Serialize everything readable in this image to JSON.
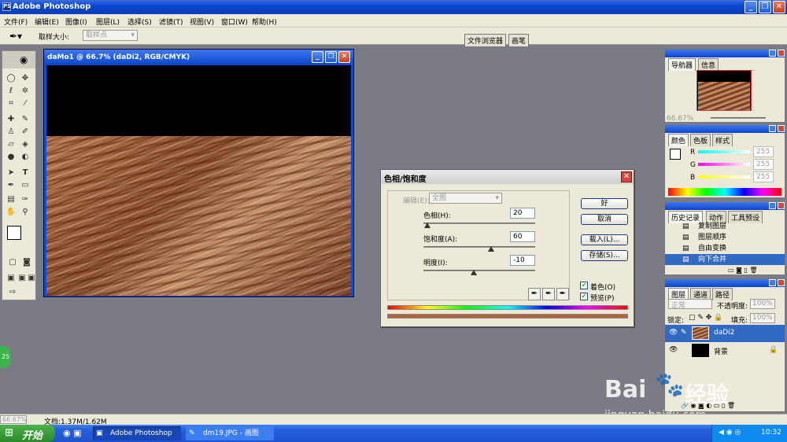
{
  "app": {
    "title": "Adobe Photoshop",
    "logo": "PS"
  },
  "window_buttons": {
    "min": "_",
    "max": "❐",
    "close": "✕"
  },
  "menu": [
    "文件(F)",
    "编辑(E)",
    "图像(I)",
    "图层(L)",
    "选择(S)",
    "滤镜(T)",
    "视图(V)",
    "窗口(W)",
    "帮助(H)"
  ],
  "options": {
    "label": "取样大小:",
    "value": "取样点",
    "tab1": "文件浏览器",
    "tab2": "画笔"
  },
  "document": {
    "title": "daMo1 @ 66.7% (daDi2, RGB/CMYK)"
  },
  "dialog": {
    "title": "色相/饱和度",
    "edit_label": "编辑(E):",
    "edit_value": "全图",
    "hue_label": "色相(H):",
    "hue_value": "20",
    "sat_label": "饱和度(A):",
    "sat_value": "60",
    "light_label": "明度(I):",
    "light_value": "-10",
    "ok": "好",
    "cancel": "取消",
    "load": "载入(L)...",
    "save": "存储(S)...",
    "colorize": "着色(O)",
    "preview": "预览(P)"
  },
  "navigator": {
    "tab1": "导航器",
    "tab2": "信息",
    "zoom": "66.67%"
  },
  "color": {
    "tab1": "颜色",
    "tab2": "色板",
    "tab3": "样式",
    "r": "R",
    "g": "G",
    "b": "B",
    "r_val": "255",
    "g_val": "255",
    "b_val": "255"
  },
  "history": {
    "tab1": "历史记录",
    "tab2": "动作",
    "tab3": "工具预设",
    "items": [
      "复制图层",
      "图层顺序",
      "自由变换",
      "向下合并"
    ]
  },
  "layers": {
    "tab1": "图层",
    "tab2": "通道",
    "tab3": "路径",
    "mode": "正常",
    "opacity_label": "不透明度:",
    "opacity": "100%",
    "lock_label": "锁定:",
    "fill_label": "填充:",
    "fill": "100%",
    "rows": [
      "daDi2",
      "背景"
    ]
  },
  "status": {
    "zoom": "66.67%",
    "doc": "文档:1.37M/1.62M"
  },
  "taskbar": {
    "start": "开始",
    "task1": "Adobe Photoshop",
    "task2": "dm19.JPG - 画图",
    "time": "10:32",
    "badge": "25"
  },
  "watermark": {
    "brand": "Bai",
    "brand2": "经验",
    "url": "jingyan.baidu.com"
  }
}
